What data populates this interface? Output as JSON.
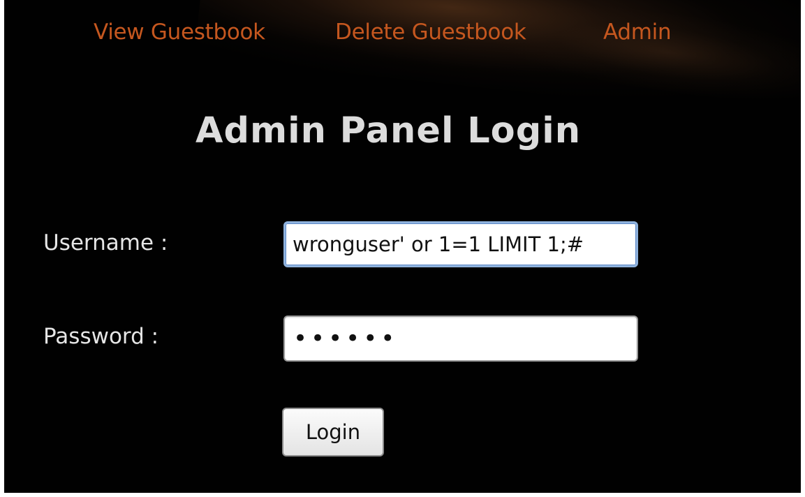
{
  "nav": {
    "items": [
      {
        "label": "View Guestbook"
      },
      {
        "label": "Delete Guestbook"
      },
      {
        "label": "Admin"
      }
    ]
  },
  "page": {
    "title": "Admin Panel Login"
  },
  "form": {
    "username": {
      "label": "Username :",
      "value": "wronguser' or 1=1 LIMIT 1;#"
    },
    "password": {
      "label": "Password :",
      "masked_value": "••••••"
    },
    "submit_label": "Login"
  },
  "colors": {
    "background": "#010101",
    "nav_link": "#c5571f",
    "title": "#dcdcdc",
    "label": "#e6e6e6",
    "focus_border": "#8fb2dd"
  }
}
